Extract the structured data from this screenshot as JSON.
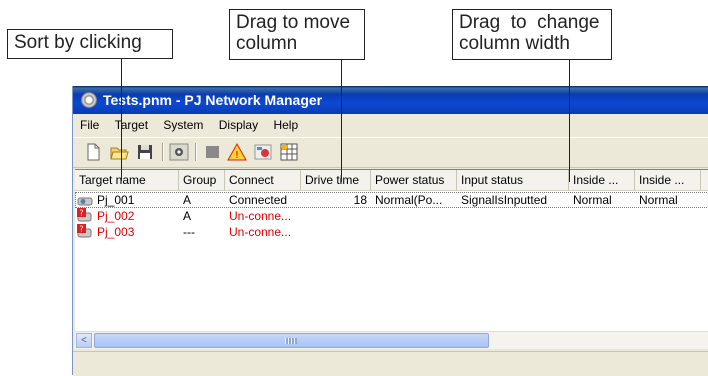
{
  "callouts": {
    "sort": "Sort by clicking",
    "move": "Drag to move\ncolumn",
    "move_line1": "Drag to move",
    "move_line2": "column",
    "width_line1": "Drag  to  change",
    "width_line2": "column width"
  },
  "window": {
    "title": "Tests.pnm - PJ Network Manager",
    "title_visible": "ts.pnm - PJ Network Manager"
  },
  "menu": [
    "File",
    "Target",
    "System",
    "Display",
    "Help"
  ],
  "menu_visible": [
    "File",
    "rget",
    "System",
    "Display",
    "Help"
  ],
  "toolbar": {
    "icons": [
      "new-file-icon",
      "open-folder-icon",
      "save-icon",
      "monitor-icon",
      "stop-icon",
      "warning-icon",
      "settings-icon",
      "grid-icon"
    ]
  },
  "columns": [
    "Target name",
    "Group",
    "Connect",
    "Drive time",
    "Power status",
    "Input status",
    "Inside ...",
    "Inside ..."
  ],
  "columns_visible": [
    "Target",
    "ame",
    "Group",
    "Connect",
    "Drive",
    "me",
    "Power status",
    "Input status",
    "Inside ...",
    "Inside ..."
  ],
  "rows": [
    {
      "name": "Pj_001",
      "group": "A",
      "connect": "Connected",
      "drive_time": "18",
      "power": "Normal(Po...",
      "input": "SignalIsInputted",
      "inside1": "Normal",
      "inside2": "Normal",
      "status_color": "#000000"
    },
    {
      "name": "Pj_002",
      "group": "A",
      "connect": "Un-conne...",
      "drive_time": "",
      "power": "",
      "input": "",
      "inside1": "",
      "inside2": "",
      "status_color": "#e00000"
    },
    {
      "name": "Pj_003",
      "group": "---",
      "connect": "Un-conne...",
      "drive_time": "",
      "power": "",
      "input": "",
      "inside1": "",
      "inside2": "",
      "status_color": "#e00000"
    }
  ],
  "scrollbar": {
    "left_arrow": "<",
    "thumb_grip": "III"
  },
  "colors": {
    "title_bar": "#0b49d4",
    "error_text": "#e00000",
    "window_bg": "#ece9d8"
  }
}
